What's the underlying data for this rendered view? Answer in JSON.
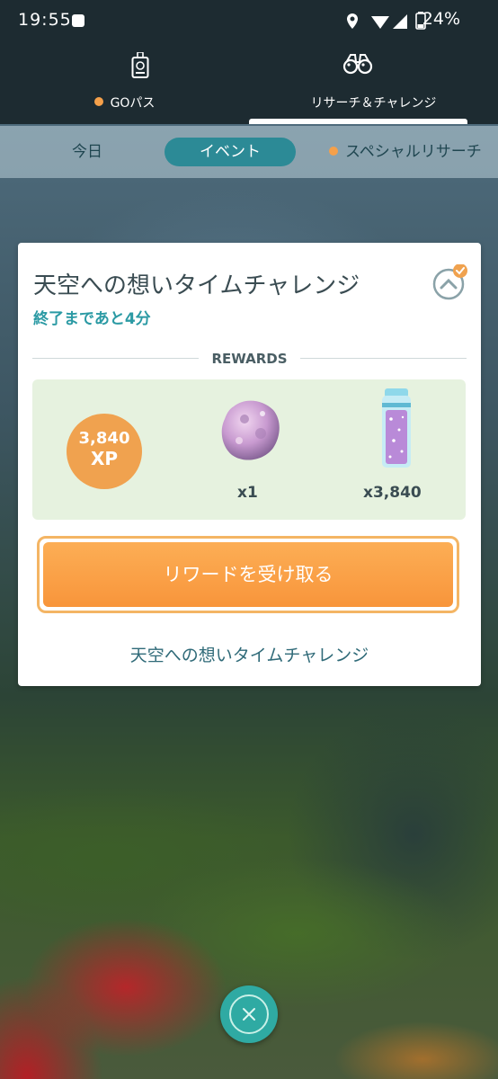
{
  "status_bar": {
    "time": "19:55",
    "battery": "24%"
  },
  "top_nav": {
    "tabs": [
      {
        "label": "GOパス",
        "has_dot": true
      },
      {
        "label": "リサーチ＆チャレンジ",
        "active": true
      }
    ]
  },
  "sub_tabs": [
    {
      "label": "今日"
    },
    {
      "label": "イベント",
      "active": true
    },
    {
      "label": "スペシャルリサーチ",
      "has_dot": true
    }
  ],
  "card": {
    "title": "天空への想いタイムチャレンジ",
    "time_remaining": "終了まであと4分",
    "rewards_header": "REWARDS",
    "rewards": {
      "xp_amount": "3,840",
      "xp_label": "XP",
      "items": [
        {
          "icon": "meteorite-icon",
          "quantity": "x1"
        },
        {
          "icon": "stardust-tube-icon",
          "quantity": "x3,840"
        }
      ]
    },
    "claim_button_label": "リワードを受け取る",
    "footer_title": "天空への想いタイムチャレンジ"
  },
  "colors": {
    "accent": "#2b9aa4",
    "orange": "#f8953b",
    "reward_bg": "#e6f2df"
  }
}
